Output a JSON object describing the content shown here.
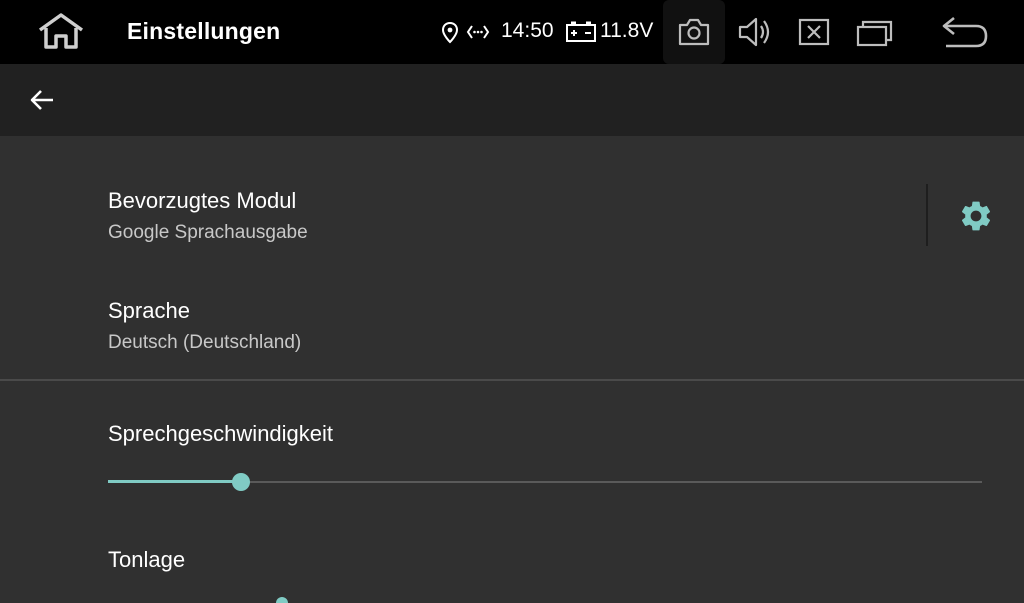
{
  "statusbar": {
    "title": "Einstellungen",
    "time": "14:50",
    "voltage": "11.8V",
    "icons": {
      "home": "home-icon",
      "location": "location-pin-icon",
      "nfc": "nfc-signal-icon",
      "battery": "car-battery-icon",
      "camera": "camera-icon",
      "volume": "volume-icon",
      "close": "close-app-icon",
      "recents": "recent-apps-icon",
      "back": "back-icon"
    }
  },
  "appbar": {
    "back_icon": "arrow-left-icon"
  },
  "preferences": {
    "engine": {
      "title": "Bevorzugtes Modul",
      "summary": "Google Sprachausgabe",
      "settings_icon": "gear-icon"
    },
    "language": {
      "title": "Sprache",
      "summary": "Deutsch (Deutschland)"
    },
    "speech_rate": {
      "title": "Sprechgeschwindigkeit",
      "value_fraction": 0.152
    },
    "pitch": {
      "title": "Tonlage"
    }
  },
  "colors": {
    "statusbar_bg": "#000000",
    "appbar_bg": "#212121",
    "content_bg": "#303030",
    "accent": "#80cbc4",
    "summary_text": "#c8c8c8"
  }
}
